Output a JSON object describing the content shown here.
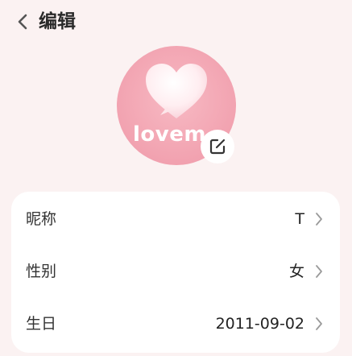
{
  "header": {
    "back_icon": "chevron-left-icon",
    "title": "编辑"
  },
  "avatar": {
    "text": "lovem",
    "image_icon": "heart-icon",
    "edit_icon": "edit-icon",
    "colors": {
      "background": "#f3a7b4",
      "heart": "#ffeef1",
      "badge": "#ffffff"
    }
  },
  "profile": {
    "rows": [
      {
        "label": "昵称",
        "value": "T",
        "chevron_icon": "chevron-right-icon"
      },
      {
        "label": "性别",
        "value": "女",
        "chevron_icon": "chevron-right-icon"
      },
      {
        "label": "生日",
        "value": "2011-09-02",
        "chevron_icon": "chevron-right-icon"
      }
    ]
  },
  "colors": {
    "page_background": "#fbf2f2",
    "card_background": "#ffffff",
    "text_primary": "#222222",
    "chevron": "#9a9a9a"
  }
}
